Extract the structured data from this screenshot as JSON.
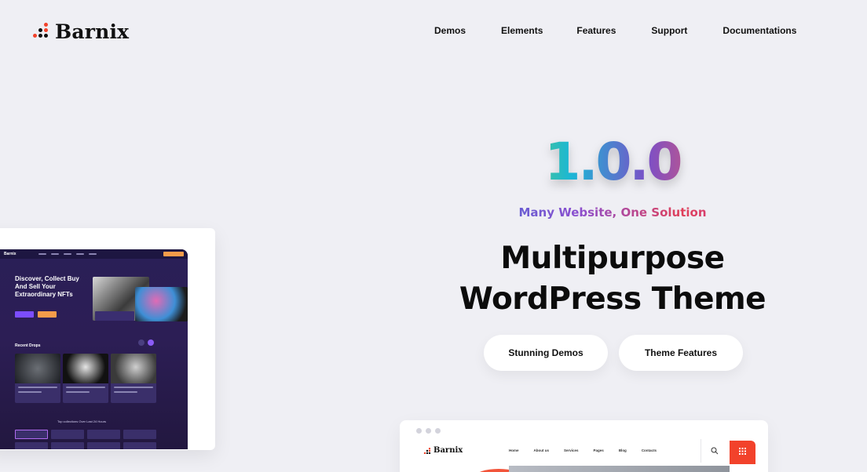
{
  "brand": {
    "name": "Barnix"
  },
  "nav": {
    "items": [
      "Demos",
      "Elements",
      "Features",
      "Support",
      "Documentations"
    ]
  },
  "hero": {
    "version": "1.0.0",
    "tagline": "Many Website, One Solution",
    "headline_line1": "Multipurpose",
    "headline_line2": "WordPress Theme",
    "primary_button": "Stunning Demos",
    "secondary_button": "Theme Features"
  },
  "nft_preview": {
    "logo": "Barnix",
    "title_line1": "Discover, Collect Buy",
    "title_line2": "And Sell Your",
    "title_line3": "Extraordinary NFTs",
    "recent_label": "Recent Drops",
    "collections_label": "Top collections Over Last 24 Hours"
  },
  "barnix_preview": {
    "logo": "Barnix",
    "nav": [
      "Home",
      "About us",
      "Services",
      "Pages",
      "Blog",
      "Contacts"
    ]
  },
  "colors": {
    "logo_dot_red": "#f2422b",
    "logo_dot_dark": "#111111",
    "accent_orange": "#f2553b",
    "page_bg": "#efeff4"
  }
}
